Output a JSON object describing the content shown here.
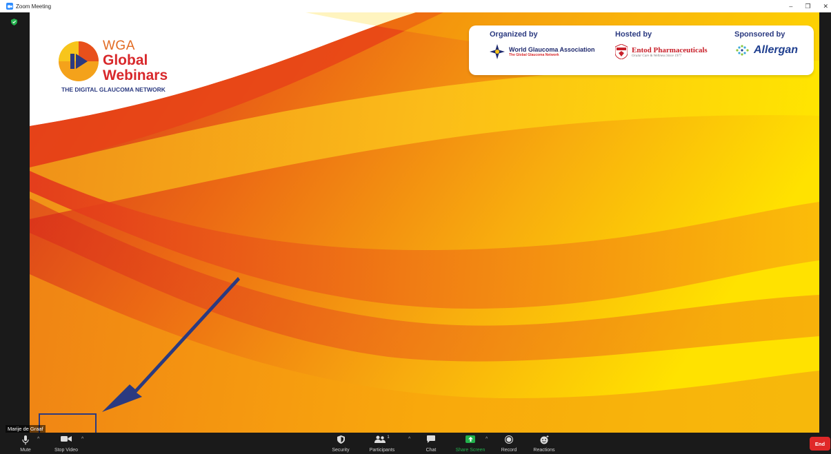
{
  "window": {
    "title": "Zoom Meeting",
    "minimize": "–",
    "restore": "❐",
    "close": "✕"
  },
  "slide": {
    "logo": {
      "line1": "WGA",
      "line2": "Global",
      "line3": "Webinars",
      "tagline": "THE DIGITAL GLAUCOMA NETWORK"
    },
    "organized": {
      "heading": "Organized by",
      "name": "World Glaucoma Association",
      "sub": "The Global Glaucoma Network"
    },
    "hosted": {
      "heading": "Hosted by",
      "name": "Entod Pharmaceuticals",
      "sub": "Ocular Care & Wellness Since 1977",
      "badge": "ENTOD"
    },
    "sponsored": {
      "heading": "Sponsored by",
      "name": "Allergan"
    }
  },
  "participant_name": "Marije de Graaf",
  "toolbar": {
    "mute": "Mute",
    "stop_video": "Stop Video",
    "security": "Security",
    "participants": "Participants",
    "participants_count": "1",
    "chat": "Chat",
    "share_screen": "Share Screen",
    "record": "Record",
    "reactions": "Reactions",
    "end": "End",
    "caret": "^"
  },
  "colors": {
    "share_green": "#22b14c",
    "end_red": "#e02828",
    "annotation_blue": "#2b3a80",
    "brand_red": "#d8282b",
    "brand_blue": "#2b3a80"
  }
}
